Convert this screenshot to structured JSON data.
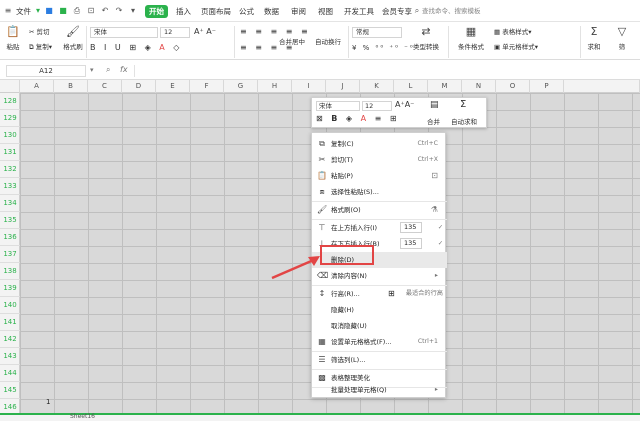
{
  "menubar": {
    "file_label": "文件",
    "tabs": [
      "开始",
      "插入",
      "页面布局",
      "公式",
      "数据",
      "审阅",
      "视图",
      "开发工具",
      "会员专享"
    ],
    "active_tab": "开始",
    "search_placeholder": "查找命令、搜索模板"
  },
  "ribbon": {
    "paste": "粘贴",
    "cut": "剪切",
    "copy": "复制",
    "format_painter": "格式刷",
    "font_name": "宋体",
    "font_size": "12",
    "merge_center": "合并居中",
    "wrap_text": "自动换行",
    "number_format": "常规",
    "type_convert": "类型转换",
    "conditional_format": "条件格式",
    "table_style": "表格样式",
    "cell_style": "单元格样式",
    "sum": "求和",
    "filter": "筛"
  },
  "formulabar": {
    "name_box": "A12",
    "fx": "fx"
  },
  "grid": {
    "columns": [
      "A",
      "B",
      "C",
      "D",
      "E",
      "F",
      "G",
      "H",
      "I",
      "J",
      "K",
      "L",
      "M",
      "N",
      "O",
      "P"
    ],
    "rows": [
      "128",
      "129",
      "130",
      "131",
      "132",
      "133",
      "134",
      "135",
      "136",
      "137",
      "138",
      "139",
      "140",
      "141",
      "142",
      "143",
      "144",
      "145",
      "146"
    ],
    "cell_value": "1"
  },
  "statusbar": {
    "sheet_name": "Sheet16"
  },
  "mini_toolbar": {
    "font_name": "宋体",
    "font_size": "12",
    "merge": "合并",
    "autosum": "自动求和"
  },
  "context_menu": {
    "copy": {
      "label": "复制(C)",
      "shortcut": "Ctrl+C"
    },
    "cut": {
      "label": "剪切(T)",
      "shortcut": "Ctrl+X"
    },
    "paste": {
      "label": "粘贴(P)"
    },
    "paste_special": {
      "label": "选择性粘贴(S)..."
    },
    "format_painter": {
      "label": "格式刷(O)"
    },
    "insert_above": {
      "label": "在上方插入行(I)",
      "value": "135"
    },
    "insert_below": {
      "label": "在下方插入行(B)",
      "value": "135"
    },
    "delete": {
      "label": "删除(D)"
    },
    "clear_content": {
      "label": "清除内容(N)"
    },
    "row_height": {
      "label": "行高(R)...",
      "extra": "最适合的行高"
    },
    "hide": {
      "label": "隐藏(H)"
    },
    "unhide": {
      "label": "取消隐藏(U)"
    },
    "cell_format": {
      "label": "设置单元格格式(F)...",
      "shortcut": "Ctrl+1"
    },
    "filter_rows": {
      "label": "筛选列(L)..."
    },
    "beautify": {
      "label": "表格整理美化"
    },
    "batch": {
      "label": "批量处理单元格(Q)"
    }
  },
  "colors": {
    "accent": "#2bb24c",
    "highlight": "#e24545",
    "selection_fill": "#d9d9d9"
  }
}
